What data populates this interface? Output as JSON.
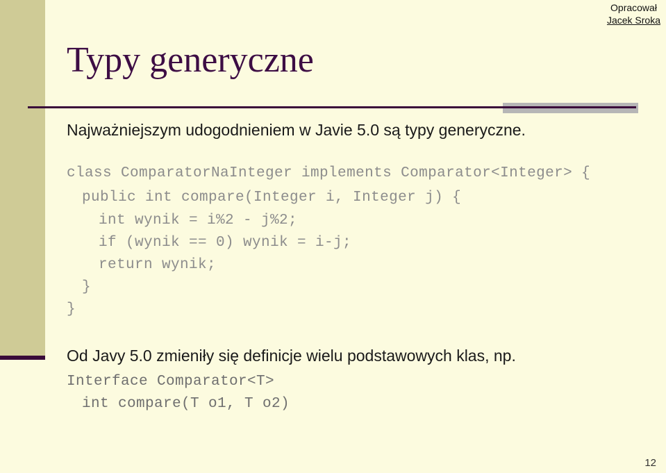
{
  "slide": {
    "background_color": "#fcfbdf",
    "accent_color": "#3a0b3a",
    "band_color": "#cfcb96",
    "shadow_color": "#b6b6b6",
    "page_number": "12"
  },
  "header": {
    "author_label": "Opracował",
    "author_name": "Jacek Sroka"
  },
  "title": "Typy generyczne",
  "body": {
    "intro_text": "Najważniejszym udogodnieniem w Javie 5.0 są typy generyczne.",
    "outro_text": "Od Javy 5.0 zmieniły się definicje wielu podstawowych klas, np."
  },
  "code_block_1": {
    "lines": [
      "class ComparatorNaInteger implements Comparator<Integer> {",
      "public int compare(Integer i, Integer j) {",
      "int wynik = i%2 - j%2;",
      "if (wynik == 0) wynik = i-j;",
      "return wynik;",
      "}",
      "}"
    ]
  },
  "code_block_2": {
    "lines": [
      "Interface Comparator<T>",
      "int compare(T o1, T o2)"
    ]
  }
}
